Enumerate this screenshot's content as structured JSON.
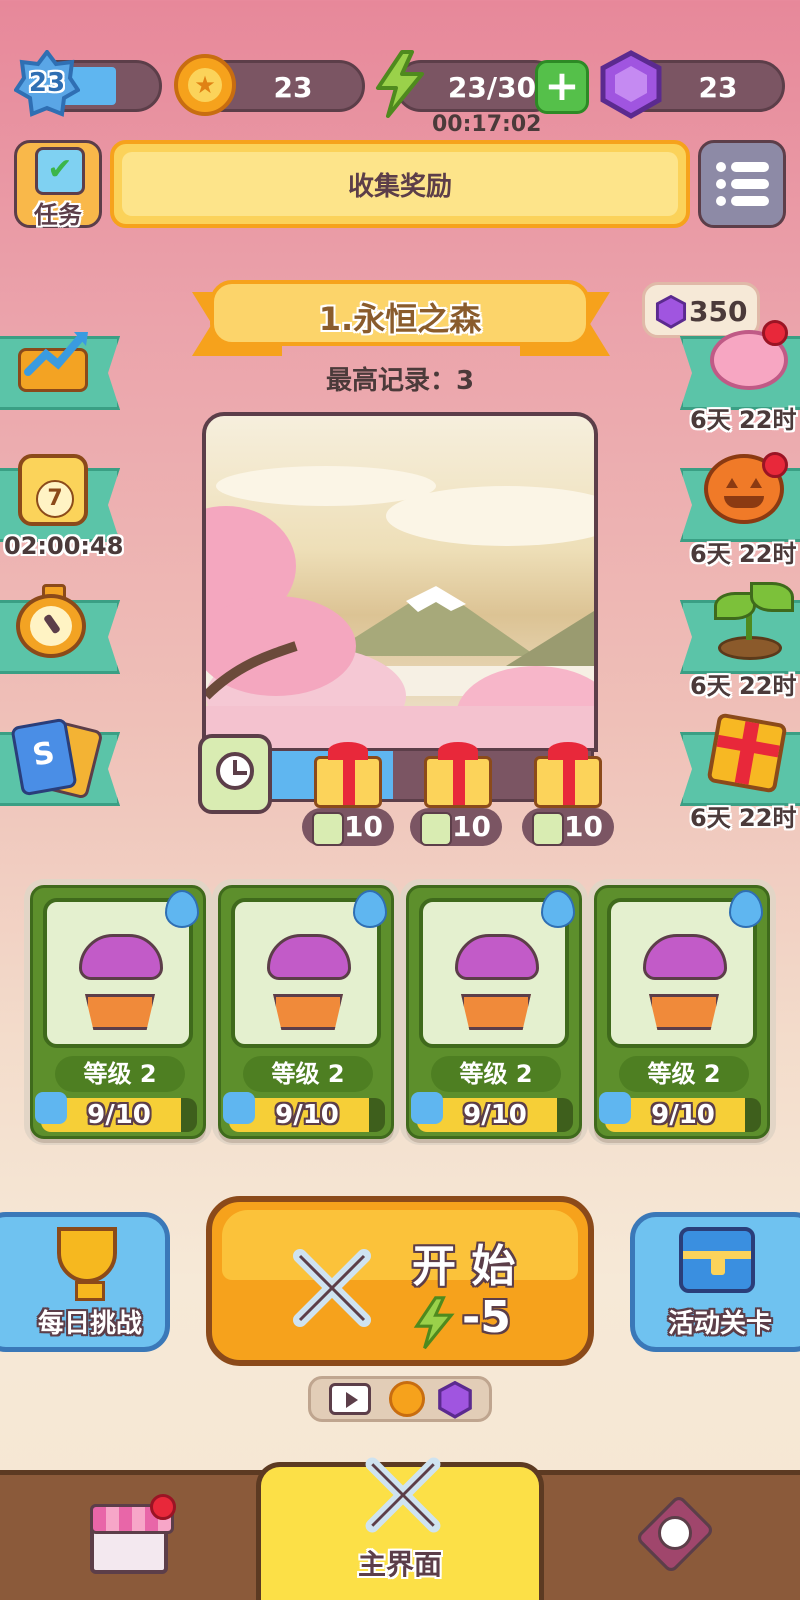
{
  "player": {
    "level": "23",
    "xp_progress": 0.55
  },
  "coins": "23",
  "energy": {
    "value": "23/30",
    "timer": "00:17:02"
  },
  "gems": "23",
  "tasks_label": "任务",
  "collect_reward_label": "收集奖励",
  "stage": {
    "title": "1.永恒之森",
    "best_record": "最高记录：3",
    "gem_offer": "350"
  },
  "left_events": [
    {
      "icon": "growth-chart-icon",
      "timer": ""
    },
    {
      "icon": "calendar-7-icon",
      "badge": "7",
      "timer": "02:00:48"
    },
    {
      "icon": "stopwatch-icon",
      "timer": ""
    },
    {
      "icon": "skill-cards-icon",
      "timer": ""
    }
  ],
  "right_events": [
    {
      "icon": "piggy-bank-icon",
      "timer": "6天 22时"
    },
    {
      "icon": "pumpkin-icon",
      "timer": "6天 22时"
    },
    {
      "icon": "sprout-icon",
      "timer": "6天 22时"
    },
    {
      "icon": "gift-box-icon",
      "timer": "6天 22时"
    }
  ],
  "chest_costs": [
    "10",
    "10",
    "10"
  ],
  "cards": [
    {
      "level": "等级 2",
      "progress": "9/10",
      "fraction": 0.9
    },
    {
      "level": "等级 2",
      "progress": "9/10",
      "fraction": 0.9
    },
    {
      "level": "等级 2",
      "progress": "9/10",
      "fraction": 0.9
    },
    {
      "level": "等级 2",
      "progress": "9/10",
      "fraction": 0.9
    }
  ],
  "daily_challenge_label": "每日挑战",
  "start": {
    "label": "开 始",
    "cost": "-5"
  },
  "event_stage_label": "活动关卡",
  "nav": {
    "home_label": "主界面"
  },
  "colors": {
    "accent_orange": "#f6a21c",
    "card_green": "#5d8f2c",
    "tab_teal": "#5bc4a8"
  }
}
